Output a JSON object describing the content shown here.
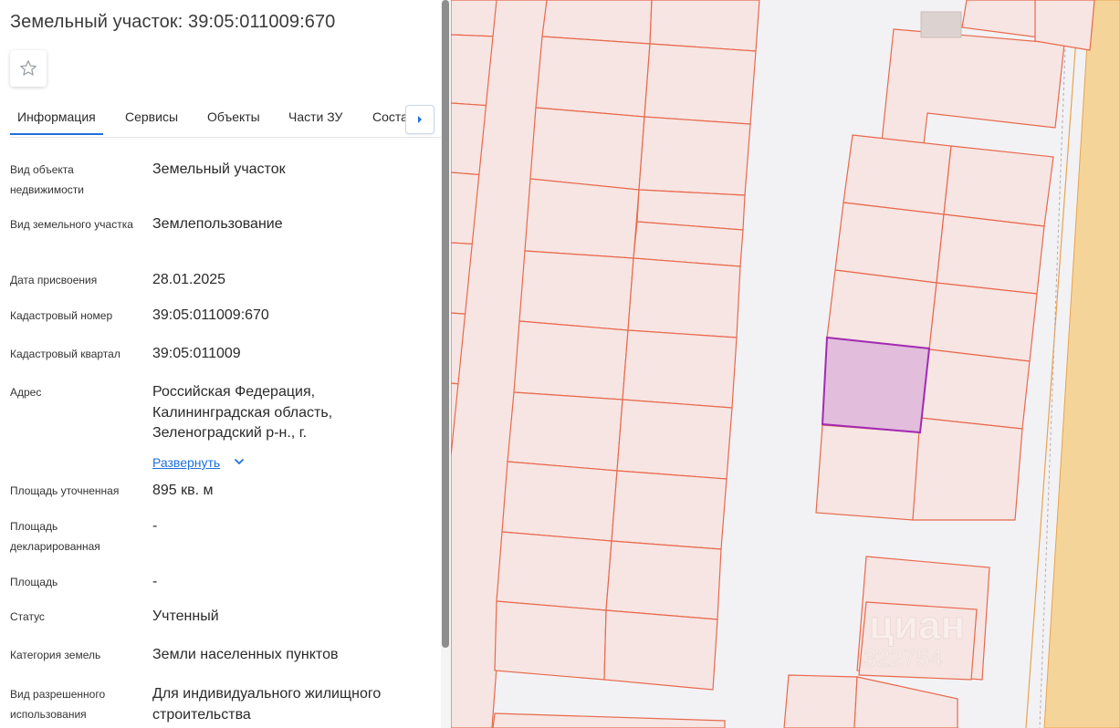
{
  "title": "Земельный участок: 39:05:011009:670",
  "tabs": [
    {
      "label": "Информация",
      "active": true
    },
    {
      "label": "Сервисы"
    },
    {
      "label": "Объекты"
    },
    {
      "label": "Части ЗУ"
    },
    {
      "label": "Соста"
    }
  ],
  "info": {
    "object_type": {
      "label": "Вид объекта недвижимости",
      "value": "Земельный участок"
    },
    "land_type": {
      "label": "Вид земельного участка",
      "value": "Землепользование"
    },
    "assign_date": {
      "label": "Дата присвоения",
      "value": "28.01.2025"
    },
    "cadastral_number": {
      "label": "Кадастровый номер",
      "value": "39:05:011009:670"
    },
    "cadastral_block": {
      "label": "Кадастровый квартал",
      "value": "39:05:011009"
    },
    "address": {
      "label": "Адрес",
      "value": "Российская Федерация, Калининградская область, Зеленоградский р-н., г.",
      "expand": "Развернуть"
    },
    "area_specified": {
      "label": "Площадь уточненная",
      "value": "895 кв. м"
    },
    "area_declared": {
      "label": "Площадь декларированная",
      "value": "-"
    },
    "area": {
      "label": "Площадь",
      "value": "-"
    },
    "status": {
      "label": "Статус",
      "value": "Учтенный"
    },
    "land_category": {
      "label": "Категория земель",
      "value": "Земли населенных пунктов"
    },
    "permitted_use": {
      "label": "Вид разрешенного использования",
      "value": "Для индивидуального жилищного строительства"
    }
  },
  "map": {
    "watermark": "циан",
    "watermark_id": "322754",
    "colors": {
      "parcel_fill": "#f6e5e2",
      "parcel_stroke": "#e8694d",
      "selected_fill": "#e2bddc",
      "selected_stroke": "#a22ab2",
      "road": "#f5d49a",
      "road_stroke": "#e8a34e",
      "background": "#f2f2f5",
      "building": "#dcd2d0"
    }
  }
}
